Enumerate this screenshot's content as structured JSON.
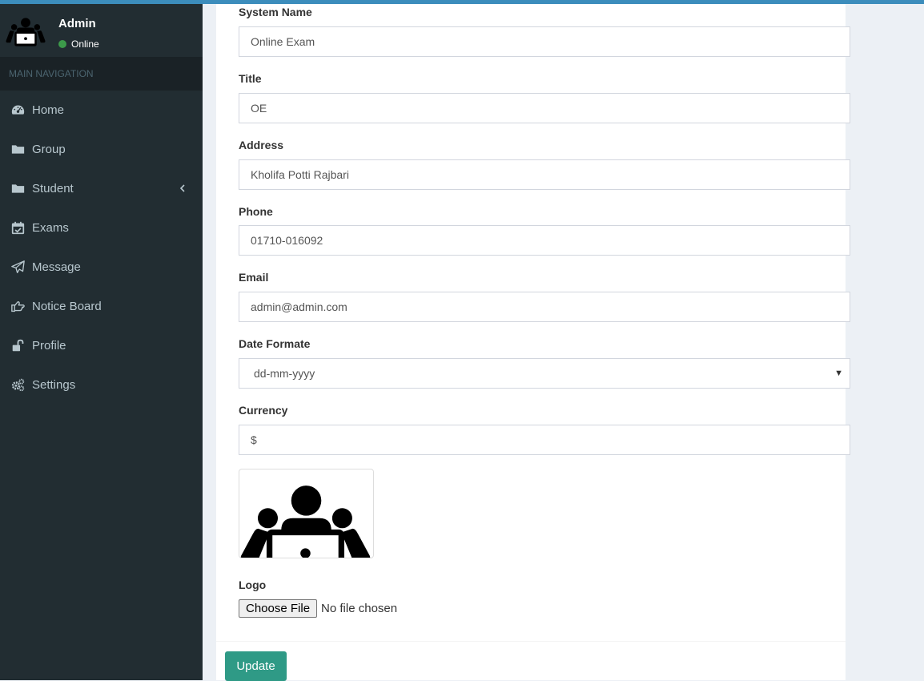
{
  "user": {
    "name": "Admin",
    "status": "Online"
  },
  "sidebar": {
    "header": "MAIN NAVIGATION",
    "items": [
      {
        "label": "Home",
        "icon": "dashboard-icon"
      },
      {
        "label": "Group",
        "icon": "folder-icon"
      },
      {
        "label": "Student",
        "icon": "folder-icon"
      },
      {
        "label": "Exams",
        "icon": "calendar-check-icon"
      },
      {
        "label": "Message",
        "icon": "paper-plane-icon"
      },
      {
        "label": "Notice Board",
        "icon": "hand-point-icon"
      },
      {
        "label": "Profile",
        "icon": "unlock-icon"
      },
      {
        "label": "Settings",
        "icon": "gears-icon"
      }
    ]
  },
  "form": {
    "system_name": {
      "label": "System Name",
      "value": "Online Exam"
    },
    "title": {
      "label": "Title",
      "value": "OE"
    },
    "address": {
      "label": "Address",
      "value": "Kholifa Potti Rajbari"
    },
    "phone": {
      "label": "Phone",
      "value": "01710-016092"
    },
    "email": {
      "label": "Email",
      "value": "admin@admin.com"
    },
    "date_format": {
      "label": "Date Formate",
      "value": "dd-mm-yyyy"
    },
    "currency": {
      "label": "Currency",
      "value": "$"
    },
    "logo": {
      "label": "Logo",
      "button": "Choose File",
      "status": "No file chosen"
    }
  },
  "footer": {
    "update_label": "Update"
  },
  "colors": {
    "topbar": "#3c8dbc",
    "sidebar": "#222d32",
    "accent": "#2f9a86",
    "online": "#3c9a4a"
  }
}
